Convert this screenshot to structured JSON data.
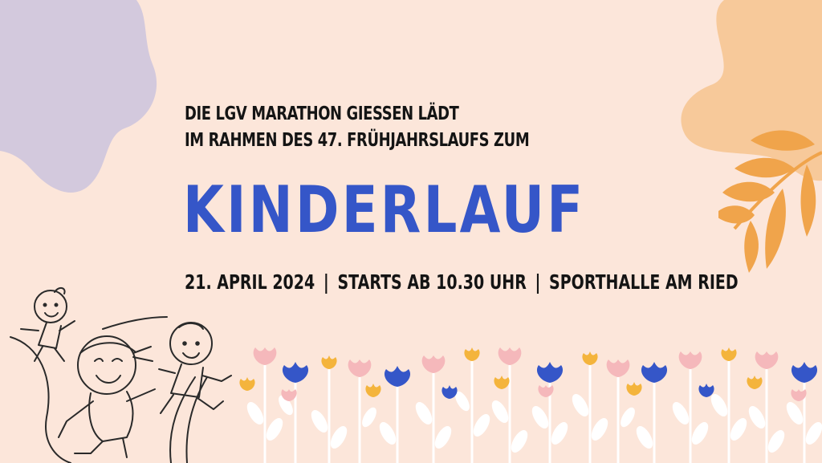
{
  "headline": {
    "line1": "DIE LGV MARATHON GIESSEN LÄDT",
    "line2": "IM RAHMEN DES 47. FRÜHJAHRSLAUFS ZUM"
  },
  "title": "KINDERLAUF",
  "details": {
    "date": "21. APRIL 2024",
    "separator": "|",
    "start": "STARTS AB 10.30 UHR",
    "venue": "SPORTHALLE AM RIED"
  },
  "colors": {
    "background": "#fce6da",
    "title_blue": "#3556c8",
    "text": "#141414",
    "lilac_blob": "#d3c9dd",
    "peach_blob": "#f7c99a",
    "leaf_orange": "#f0a44b",
    "flower_pink": "#f5b8bb",
    "flower_blue": "#3556c8",
    "flower_yellow": "#f4b43c"
  },
  "decor": {
    "top_left": "lilac-blob",
    "top_right": "peach-blob",
    "right": "orange-leaf-branch",
    "bottom_left": "running-children-line-drawing",
    "bottom": "flower-meadow"
  }
}
